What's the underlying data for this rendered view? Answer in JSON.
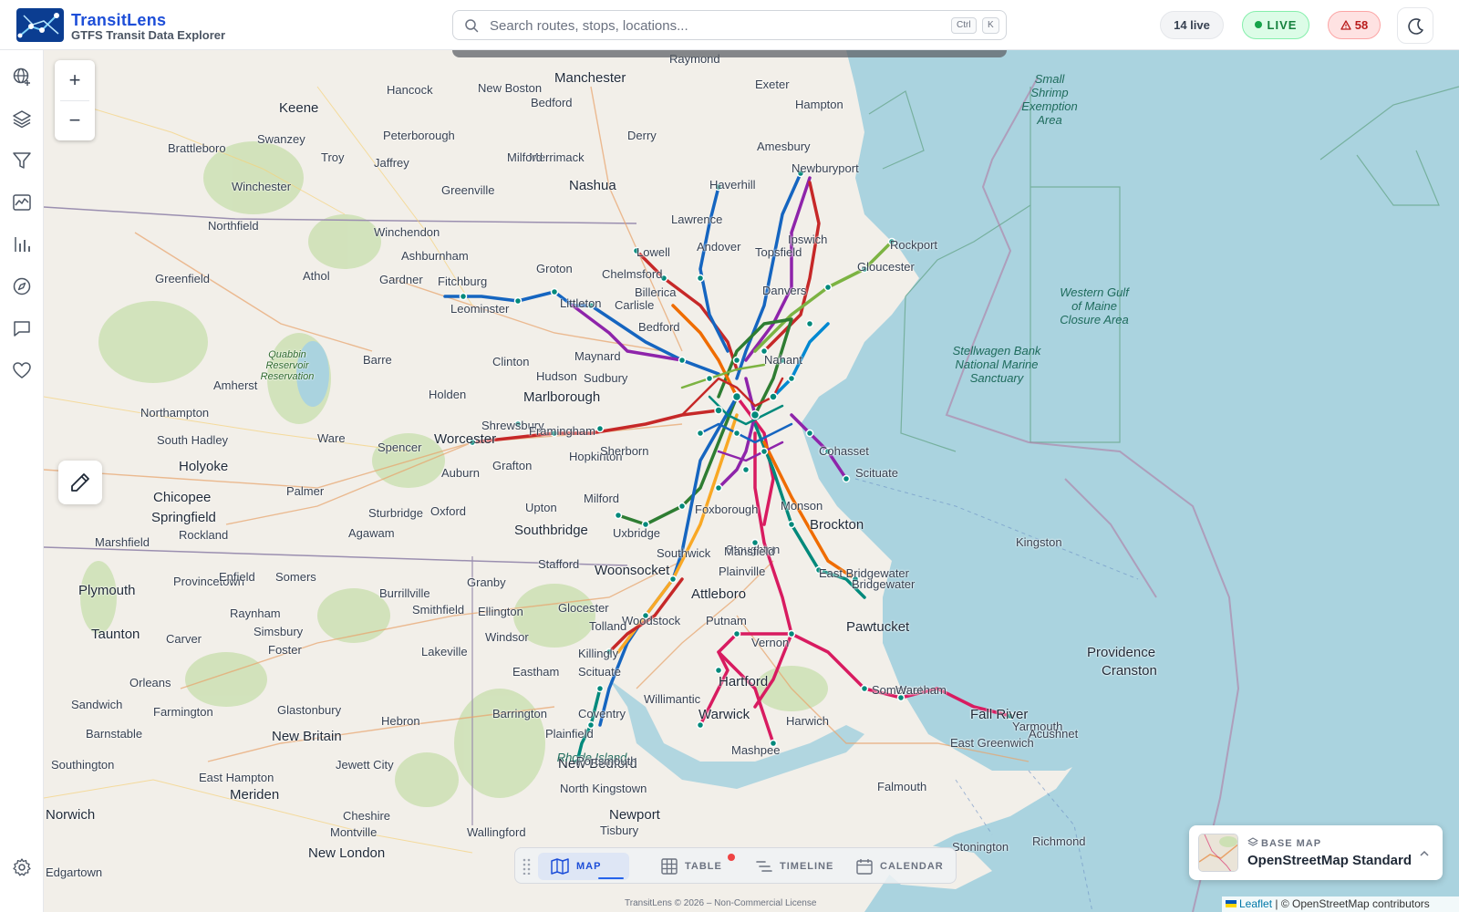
{
  "app": {
    "name": "TransitLens",
    "subtitle": "GTFS Transit Data Explorer"
  },
  "search": {
    "placeholder": "Search routes, stops, locations...",
    "shortcut_ctrl": "Ctrl",
    "shortcut_key": "K"
  },
  "status": {
    "live_count": "14 live",
    "live_label": "LIVE",
    "alert_count": "58"
  },
  "sidebar_icons": [
    "globe-icon",
    "layers-icon",
    "filter-icon",
    "activity-icon",
    "bar-chart-icon",
    "compass-icon",
    "message-icon",
    "heart-icon",
    "settings-icon"
  ],
  "map": {
    "zoom_in": "+",
    "zoom_out": "−",
    "places": [
      {
        "name": "Manchester",
        "cls": "big"
      },
      {
        "name": "Raymond"
      },
      {
        "name": "Keene",
        "cls": "big"
      },
      {
        "name": "Hancock"
      },
      {
        "name": "New Boston"
      },
      {
        "name": "Bedford"
      },
      {
        "name": "Exeter"
      },
      {
        "name": "Hampton"
      },
      {
        "name": "Swanzey"
      },
      {
        "name": "Peterborough"
      },
      {
        "name": "Merrimack"
      },
      {
        "name": "Derry"
      },
      {
        "name": "Amesbury"
      },
      {
        "name": "Brattleboro"
      },
      {
        "name": "Troy"
      },
      {
        "name": "Jaffrey"
      },
      {
        "name": "Milford"
      },
      {
        "name": "Newburyport"
      },
      {
        "name": "Winchester"
      },
      {
        "name": "Greenville"
      },
      {
        "name": "Nashua",
        "cls": "big"
      },
      {
        "name": "Haverhill"
      },
      {
        "name": "Northfield"
      },
      {
        "name": "Winchendon"
      },
      {
        "name": "Lawrence"
      },
      {
        "name": "Ashburnham"
      },
      {
        "name": "Andover"
      },
      {
        "name": "Lowell"
      },
      {
        "name": "Topsfield"
      },
      {
        "name": "Greenfield"
      },
      {
        "name": "Athol"
      },
      {
        "name": "Gardner"
      },
      {
        "name": "Groton"
      },
      {
        "name": "Chelmsford"
      },
      {
        "name": "Ipswich"
      },
      {
        "name": "Gloucester"
      },
      {
        "name": "Rockport"
      },
      {
        "name": "Fitchburg"
      },
      {
        "name": "Billerica"
      },
      {
        "name": "Leominster"
      },
      {
        "name": "Littleton"
      },
      {
        "name": "Carlisle"
      },
      {
        "name": "Danvers"
      },
      {
        "name": "Bedford"
      },
      {
        "name": "Quabbin Reservoir Reservation",
        "cls": "park"
      },
      {
        "name": "Barre"
      },
      {
        "name": "Maynard"
      },
      {
        "name": "Clinton"
      },
      {
        "name": "Amherst"
      },
      {
        "name": "Hudson"
      },
      {
        "name": "Sudbury"
      },
      {
        "name": "Nahant"
      },
      {
        "name": "Holden"
      },
      {
        "name": "Marlborough",
        "cls": "big"
      },
      {
        "name": "Northampton"
      },
      {
        "name": "South Hadley"
      },
      {
        "name": "Shrewsbury"
      },
      {
        "name": "Framingham"
      },
      {
        "name": "Worcester",
        "cls": "big"
      },
      {
        "name": "Ware"
      },
      {
        "name": "Hopkinton"
      },
      {
        "name": "Cohasset"
      },
      {
        "name": "Holyoke",
        "cls": "big"
      },
      {
        "name": "Spencer"
      },
      {
        "name": "Sherborn"
      },
      {
        "name": "Auburn"
      },
      {
        "name": "Grafton"
      },
      {
        "name": "Scituate"
      },
      {
        "name": "Palmer"
      },
      {
        "name": "Chicopee",
        "cls": "big"
      },
      {
        "name": "Upton"
      },
      {
        "name": "Springfield",
        "cls": "big"
      },
      {
        "name": "Milford"
      },
      {
        "name": "Oxford"
      },
      {
        "name": "Sturbridge"
      },
      {
        "name": "Monson"
      },
      {
        "name": "Rockland"
      },
      {
        "name": "Agawam"
      },
      {
        "name": "Southbridge",
        "cls": "big"
      },
      {
        "name": "Uxbridge"
      },
      {
        "name": "Foxborough"
      },
      {
        "name": "Stoughton"
      },
      {
        "name": "Brockton",
        "cls": "big"
      },
      {
        "name": "Marshfield"
      },
      {
        "name": "Southwick"
      },
      {
        "name": "Mansfield"
      },
      {
        "name": "East Bridgewater"
      },
      {
        "name": "Kingston"
      },
      {
        "name": "Provincetown"
      },
      {
        "name": "Enfield"
      },
      {
        "name": "Somers"
      },
      {
        "name": "Stafford"
      },
      {
        "name": "Woonsocket",
        "cls": "big"
      },
      {
        "name": "Plainville"
      },
      {
        "name": "Bridgewater"
      },
      {
        "name": "Plymouth",
        "cls": "big"
      },
      {
        "name": "Granby"
      },
      {
        "name": "Burrillville"
      },
      {
        "name": "Woodstock"
      },
      {
        "name": "Attleboro",
        "cls": "big"
      },
      {
        "name": "Raynham"
      },
      {
        "name": "Ellington"
      },
      {
        "name": "Glocester"
      },
      {
        "name": "Smithfield"
      },
      {
        "name": "Putnam"
      },
      {
        "name": "Taunton",
        "cls": "big"
      },
      {
        "name": "Simsbury"
      },
      {
        "name": "Tolland"
      },
      {
        "name": "Pawtucket",
        "cls": "big"
      },
      {
        "name": "Carver"
      },
      {
        "name": "Windsor"
      },
      {
        "name": "Foster"
      },
      {
        "name": "Vernon"
      },
      {
        "name": "Lakeville"
      },
      {
        "name": "Killingly"
      },
      {
        "name": "Providence",
        "cls": "big"
      },
      {
        "name": "Eastham"
      },
      {
        "name": "Scituate"
      },
      {
        "name": "Cranston",
        "cls": "big"
      },
      {
        "name": "Orleans"
      },
      {
        "name": "Hartford",
        "cls": "big"
      },
      {
        "name": "Somerset"
      },
      {
        "name": "Wareham"
      },
      {
        "name": "Sandwich"
      },
      {
        "name": "Farmington"
      },
      {
        "name": "Glastonbury"
      },
      {
        "name": "Willimantic"
      },
      {
        "name": "Barrington"
      },
      {
        "name": "Coventry"
      },
      {
        "name": "Warwick",
        "cls": "big"
      },
      {
        "name": "Fall River",
        "cls": "big"
      },
      {
        "name": "Yarmouth"
      },
      {
        "name": "Harwich"
      },
      {
        "name": "Acushnet"
      },
      {
        "name": "Barnstable"
      },
      {
        "name": "New Britain",
        "cls": "big"
      },
      {
        "name": "Hebron"
      },
      {
        "name": "Plainfield"
      },
      {
        "name": "East Greenwich"
      },
      {
        "name": "Mashpee"
      },
      {
        "name": "New Bedford",
        "cls": "big"
      },
      {
        "name": "Rhode Island",
        "cls": "water"
      },
      {
        "name": "Portsmouth"
      },
      {
        "name": "Southington"
      },
      {
        "name": "Jewett City"
      },
      {
        "name": "East Hampton"
      },
      {
        "name": "North Kingstown"
      },
      {
        "name": "Falmouth"
      },
      {
        "name": "Meriden",
        "cls": "big"
      },
      {
        "name": "Norwich",
        "cls": "big"
      },
      {
        "name": "Cheshire"
      },
      {
        "name": "Newport",
        "cls": "big"
      },
      {
        "name": "Richmond"
      },
      {
        "name": "Montville"
      },
      {
        "name": "Tisbury"
      },
      {
        "name": "Wallingford"
      },
      {
        "name": "New London",
        "cls": "big"
      },
      {
        "name": "Stonington"
      },
      {
        "name": "Edgartown"
      },
      {
        "name": "Stellwagen Bank National Marine Sanctuary",
        "cls": "water"
      },
      {
        "name": "Western Gulf of Maine Closure Area",
        "cls": "water"
      },
      {
        "name": "Small Shrimp Exemption Area",
        "cls": "water"
      }
    ]
  },
  "tabs": [
    {
      "label": "MAP"
    },
    {
      "label": "TABLE"
    },
    {
      "label": "TIMELINE"
    },
    {
      "label": "CALENDAR"
    }
  ],
  "footer": {
    "license": "TransitLens © 2026 – Non-Commercial License"
  },
  "basemap": {
    "kicker": "BASE MAP",
    "name": "OpenStreetMap Standard"
  },
  "attribution": {
    "leaflet": "Leaflet",
    "osm": "| © OpenStreetMap contributors"
  },
  "colors": {
    "accent": "#1d4ed8",
    "live": "#16a34a",
    "alert": "#b91c1c",
    "water": "#aad3df",
    "land": "#f2efe9",
    "route_colors": [
      "#c62828",
      "#1565c0",
      "#8e24aa",
      "#2e7d32",
      "#f9a825",
      "#00897b",
      "#d81b60",
      "#ef6c00",
      "#7cb342",
      "#0288d1"
    ]
  }
}
